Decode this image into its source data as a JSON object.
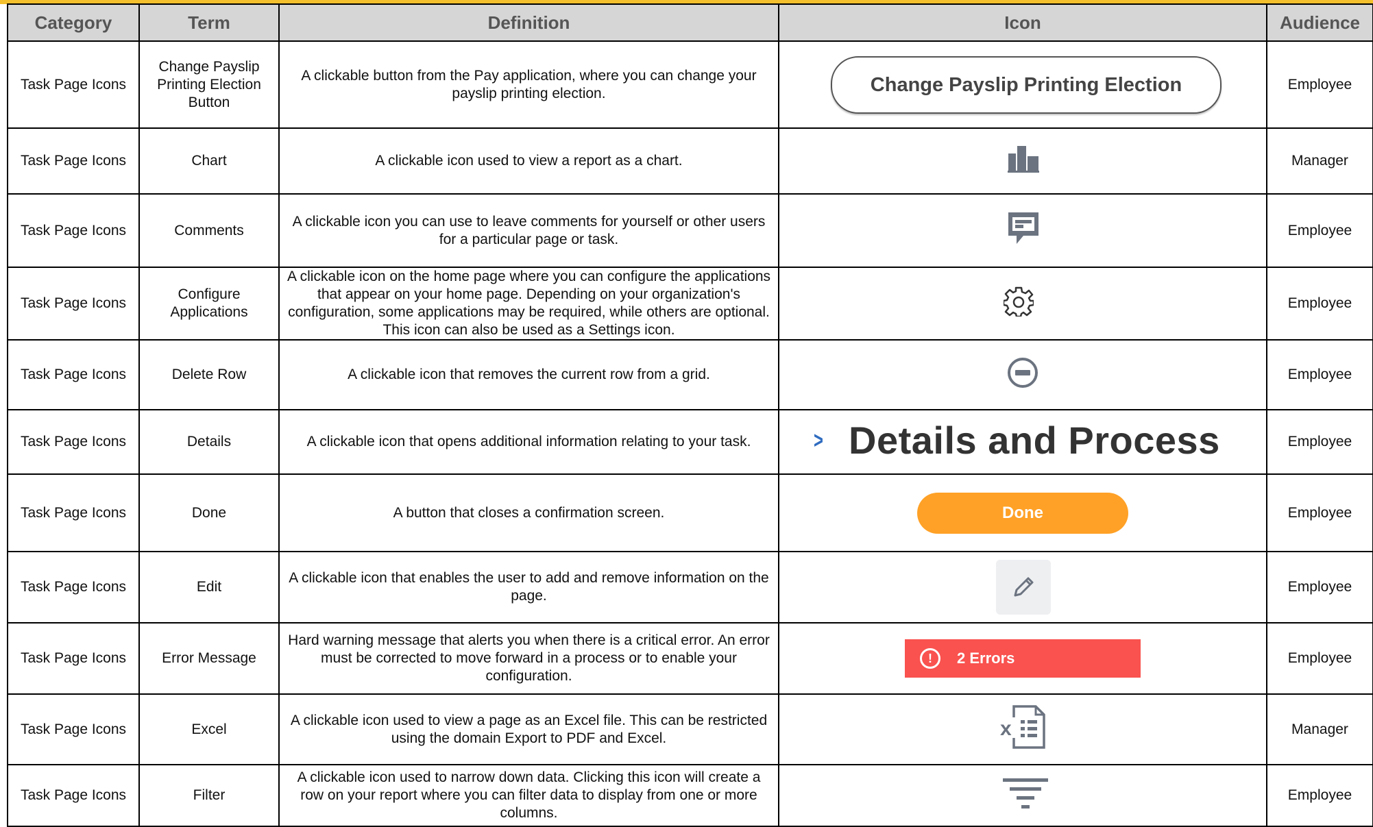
{
  "headers": {
    "category": "Category",
    "term": "Term",
    "definition": "Definition",
    "icon": "Icon",
    "audience": "Audience"
  },
  "rows": [
    {
      "category": "Task Page Icons",
      "term": "Change Payslip Printing Election Button",
      "definition": "A clickable button from the Pay application, where you can change your payslip printing election.",
      "icon": "change-payslip-button",
      "icon_text": "Change Payslip Printing Election",
      "audience": "Employee"
    },
    {
      "category": "Task Page Icons",
      "term": "Chart",
      "definition": "A clickable icon used to view a report as a chart.",
      "icon": "chart-icon",
      "audience": "Manager"
    },
    {
      "category": "Task Page Icons",
      "term": "Comments",
      "definition": "A clickable icon you can use to leave comments for yourself or other users for a particular page or task.",
      "icon": "comment-icon",
      "audience": "Employee"
    },
    {
      "category": "Task Page Icons",
      "term": "Configure Applications",
      "definition": "A clickable icon on the home page where you can configure the applications that appear on your home page. Depending on your organization's configuration, some applications may be required, while others are optional. This icon can also be used as a Settings icon.",
      "icon": "gear-icon",
      "audience": "Employee"
    },
    {
      "category": "Task Page Icons",
      "term": "Delete Row",
      "definition": "A clickable icon that removes the current row from a grid.",
      "icon": "minus-circle-icon",
      "audience": "Employee"
    },
    {
      "category": "Task Page Icons",
      "term": "Details",
      "definition": "A clickable icon that opens additional information relating to your task.",
      "icon": "details-chevron",
      "icon_text": "Details and Process",
      "audience": "Employee"
    },
    {
      "category": "Task Page Icons",
      "term": "Done",
      "definition": "A button that closes a confirmation screen.",
      "icon": "done-button",
      "icon_text": "Done",
      "audience": "Employee"
    },
    {
      "category": "Task Page Icons",
      "term": "Edit",
      "definition": "A clickable icon that enables the user to add and remove information on the page.",
      "icon": "pencil-icon",
      "audience": "Employee"
    },
    {
      "category": "Task Page Icons",
      "term": "Error Message",
      "definition": "Hard warning message that alerts you when there is a critical error. An error must be corrected to move forward in a process or to enable your configuration.",
      "icon": "error-banner",
      "icon_text": "2 Errors",
      "audience": "Employee"
    },
    {
      "category": "Task Page Icons",
      "term": "Excel",
      "definition": "A clickable icon used to view a page as an Excel file. This can be restricted using the domain Export to PDF and Excel.",
      "icon": "excel-icon",
      "audience": "Manager"
    },
    {
      "category": "Task Page Icons",
      "term": "Filter",
      "definition": "A clickable icon used to narrow down data. Clicking this icon will create a row on your report where you can filter data to display from one or more columns.",
      "icon": "filter-icon",
      "audience": "Employee"
    }
  ],
  "colors": {
    "accent_bar": "#f4c02d",
    "header_bg": "#d6d6d6",
    "done": "#ffa126",
    "error": "#f9524f",
    "icon_gray": "#6b7380",
    "link_blue": "#2f6cc0"
  }
}
